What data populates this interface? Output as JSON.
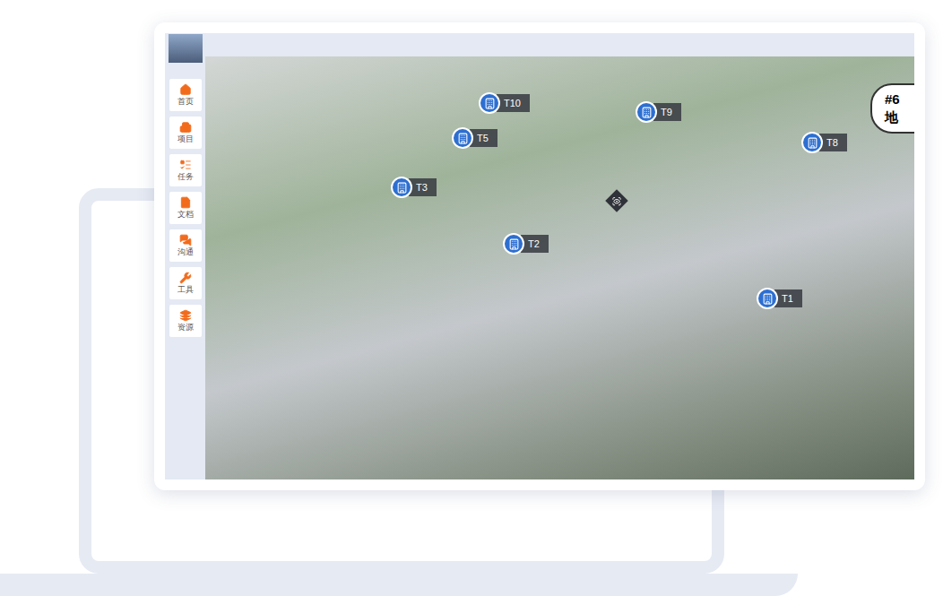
{
  "sidebar": {
    "items": [
      {
        "label": "首页"
      },
      {
        "label": "项目"
      },
      {
        "label": "任务"
      },
      {
        "label": "文档"
      },
      {
        "label": "沟通"
      },
      {
        "label": "工具"
      },
      {
        "label": "资源"
      }
    ]
  },
  "scene": {
    "markers": [
      {
        "label": "T10"
      },
      {
        "label": "T9"
      },
      {
        "label": "T5"
      },
      {
        "label": "T8"
      },
      {
        "label": "T3"
      },
      {
        "label": "T2"
      },
      {
        "label": "T1"
      }
    ],
    "callout": {
      "lines": [
        "#6",
        "地"
      ]
    }
  }
}
